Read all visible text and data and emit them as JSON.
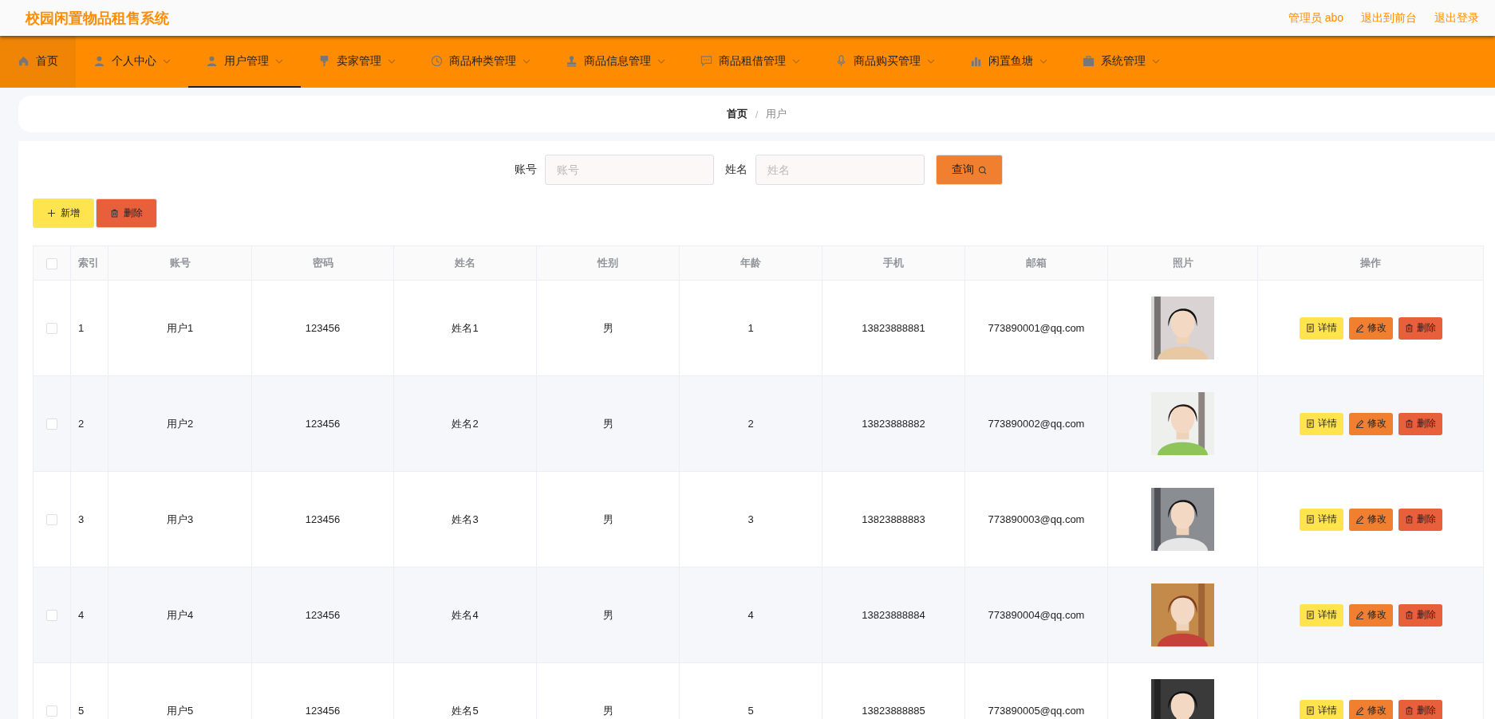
{
  "header": {
    "title": "校园闲置物品租售系统",
    "links": [
      "管理员 abo",
      "退出到前台",
      "退出登录"
    ]
  },
  "nav": [
    {
      "label": "首页",
      "selected": false,
      "dropdown": false,
      "home": true
    },
    {
      "label": "个人中心",
      "selected": false,
      "dropdown": true,
      "home": false
    },
    {
      "label": "用户管理",
      "selected": true,
      "dropdown": true,
      "home": false
    },
    {
      "label": "卖家管理",
      "selected": false,
      "dropdown": true,
      "home": false
    },
    {
      "label": "商品种类管理",
      "selected": false,
      "dropdown": true,
      "home": false
    },
    {
      "label": "商品信息管理",
      "selected": false,
      "dropdown": true,
      "home": false
    },
    {
      "label": "商品租借管理",
      "selected": false,
      "dropdown": true,
      "home": false
    },
    {
      "label": "商品购买管理",
      "selected": false,
      "dropdown": true,
      "home": false
    },
    {
      "label": "闲置鱼塘",
      "selected": false,
      "dropdown": true,
      "home": false
    },
    {
      "label": "系统管理",
      "selected": false,
      "dropdown": true,
      "home": false
    }
  ],
  "breadcrumb": {
    "items": [
      "首页",
      "用户"
    ],
    "separator": "/"
  },
  "search": {
    "fields": [
      {
        "label": "账号",
        "placeholder": "账号"
      },
      {
        "label": "姓名",
        "placeholder": "姓名"
      }
    ],
    "button": "查询"
  },
  "actions": [
    "新增",
    "删除"
  ],
  "table": {
    "header_checked": false,
    "columns": [
      "索引",
      "账号",
      "密码",
      "姓名",
      "性别",
      "年龄",
      "手机",
      "邮箱",
      "照片",
      "操作"
    ],
    "rows": [
      {
        "checked": false,
        "cells": [
          "1",
          "用户1",
          "123456",
          "姓名1",
          "男",
          "1",
          "13823888881",
          "773890001@qq.com"
        ],
        "buttons": [
          "详情",
          "修改",
          "删除"
        ]
      },
      {
        "checked": false,
        "cells": [
          "2",
          "用户2",
          "123456",
          "姓名2",
          "男",
          "2",
          "13823888882",
          "773890002@qq.com"
        ],
        "buttons": [
          "详情",
          "修改",
          "删除"
        ]
      },
      {
        "checked": false,
        "cells": [
          "3",
          "用户3",
          "123456",
          "姓名3",
          "男",
          "3",
          "13823888883",
          "773890003@qq.com"
        ],
        "buttons": [
          "详情",
          "修改",
          "删除"
        ]
      },
      {
        "checked": false,
        "cells": [
          "4",
          "用户4",
          "123456",
          "姓名4",
          "男",
          "4",
          "13823888884",
          "773890004@qq.com"
        ],
        "buttons": [
          "详情",
          "修改",
          "删除"
        ]
      },
      {
        "checked": false,
        "cells": [
          "5",
          "用户5",
          "123456",
          "姓名5",
          "男",
          "5",
          "13823888885",
          "773890005@qq.com"
        ],
        "buttons": [
          "详情",
          "修改",
          "删除"
        ]
      }
    ]
  }
}
